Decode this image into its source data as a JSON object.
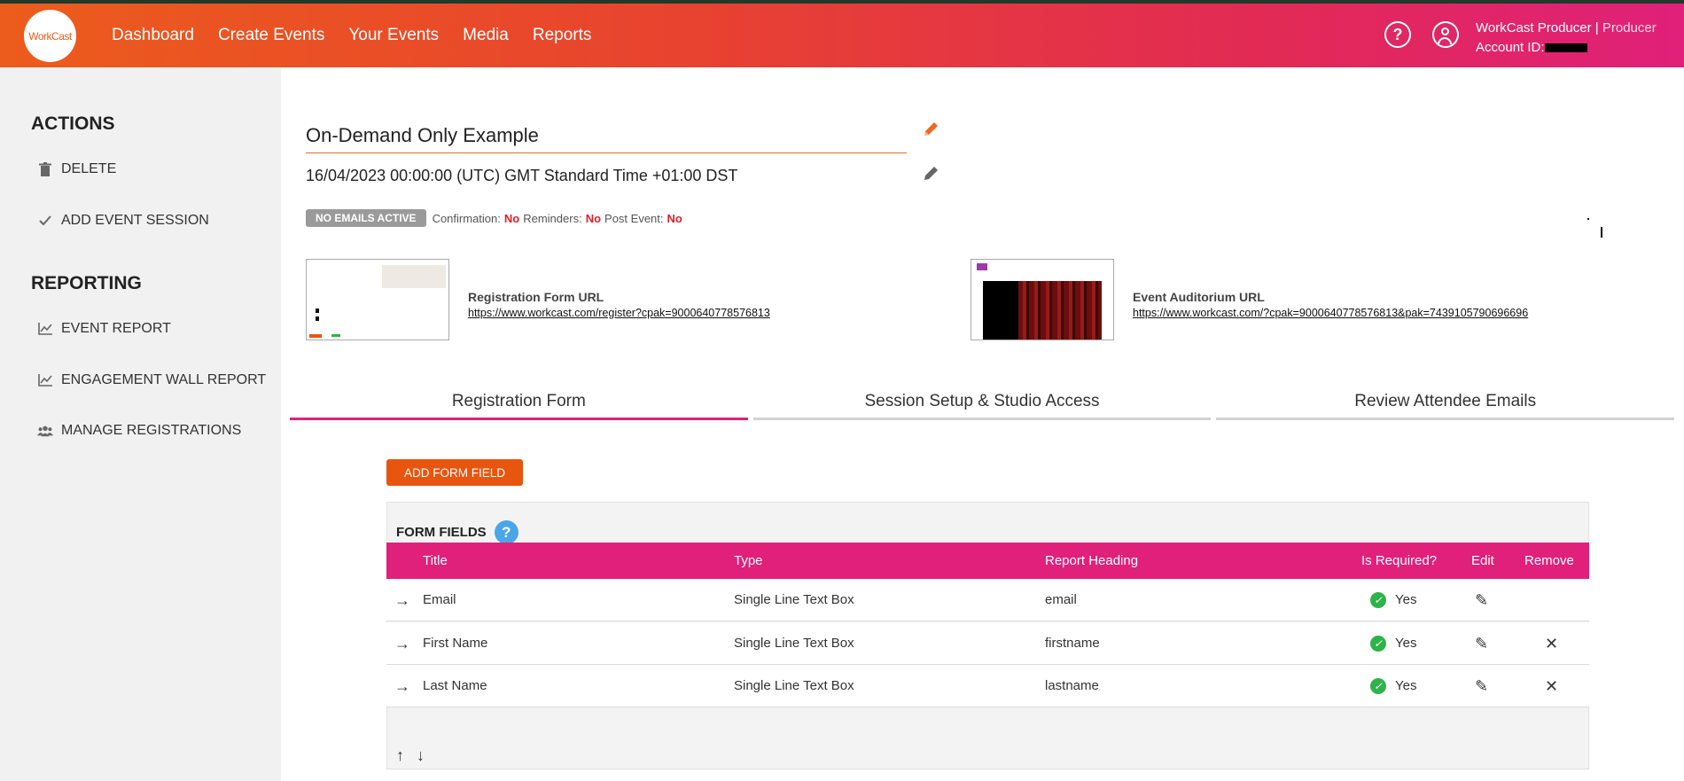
{
  "header": {
    "logo_text": "WorkCast",
    "nav": [
      "Dashboard",
      "Create Events",
      "Your Events",
      "Media",
      "Reports"
    ],
    "user_name": "WorkCast Producer",
    "separator": "|",
    "user_role": "Producer",
    "account_label": "Account ID:"
  },
  "sidebar": {
    "actions_heading": "ACTIONS",
    "delete": "DELETE",
    "add_session": "ADD EVENT SESSION",
    "reporting_heading": "REPORTING",
    "event_report": "EVENT REPORT",
    "engagement_report": "ENGAGEMENT WALL REPORT",
    "manage_registrations": "MANAGE REGISTRATIONS"
  },
  "event": {
    "title": "On-Demand Only Example",
    "datetime": "16/04/2023 00:00:00 (UTC) GMT Standard Time +01:00 DST",
    "emails_badge": "NO EMAILS ACTIVE",
    "confirmation_label": "Confirmation:",
    "confirmation_value": "No",
    "reminders_label": "Reminders:",
    "reminders_value": "No",
    "post_event_label": "Post Event:",
    "post_event_value": "No"
  },
  "urls": {
    "registration_label": "Registration Form URL",
    "registration_url": "https://www.workcast.com/register?cpak=9000640778576813",
    "auditorium_label": "Event Auditorium URL",
    "auditorium_url": "https://www.workcast.com/?cpak=9000640778576813&pak=7439105790696696"
  },
  "tabs": [
    "Registration Form",
    "Session Setup & Studio Access",
    "Review Attendee Emails"
  ],
  "form": {
    "add_button": "ADD FORM FIELD",
    "panel_title": "FORM FIELDS",
    "help": "?",
    "columns": {
      "title": "Title",
      "type": "Type",
      "report_heading": "Report Heading",
      "required": "Is Required?",
      "edit": "Edit",
      "remove": "Remove"
    },
    "rows": [
      {
        "title": "Email",
        "type": "Single Line Text Box",
        "report_heading": "email",
        "required": "Yes",
        "removable": false
      },
      {
        "title": "First Name",
        "type": "Single Line Text Box",
        "report_heading": "firstname",
        "required": "Yes",
        "removable": true
      },
      {
        "title": "Last Name",
        "type": "Single Line Text Box",
        "report_heading": "lastname",
        "required": "Yes",
        "removable": true
      }
    ]
  },
  "colors": {
    "accent_orange": "#e8550f",
    "accent_pink": "#e0207a",
    "status_red": "#e0202a",
    "check_green": "#2eb34a",
    "help_blue": "#4aa6e8"
  }
}
